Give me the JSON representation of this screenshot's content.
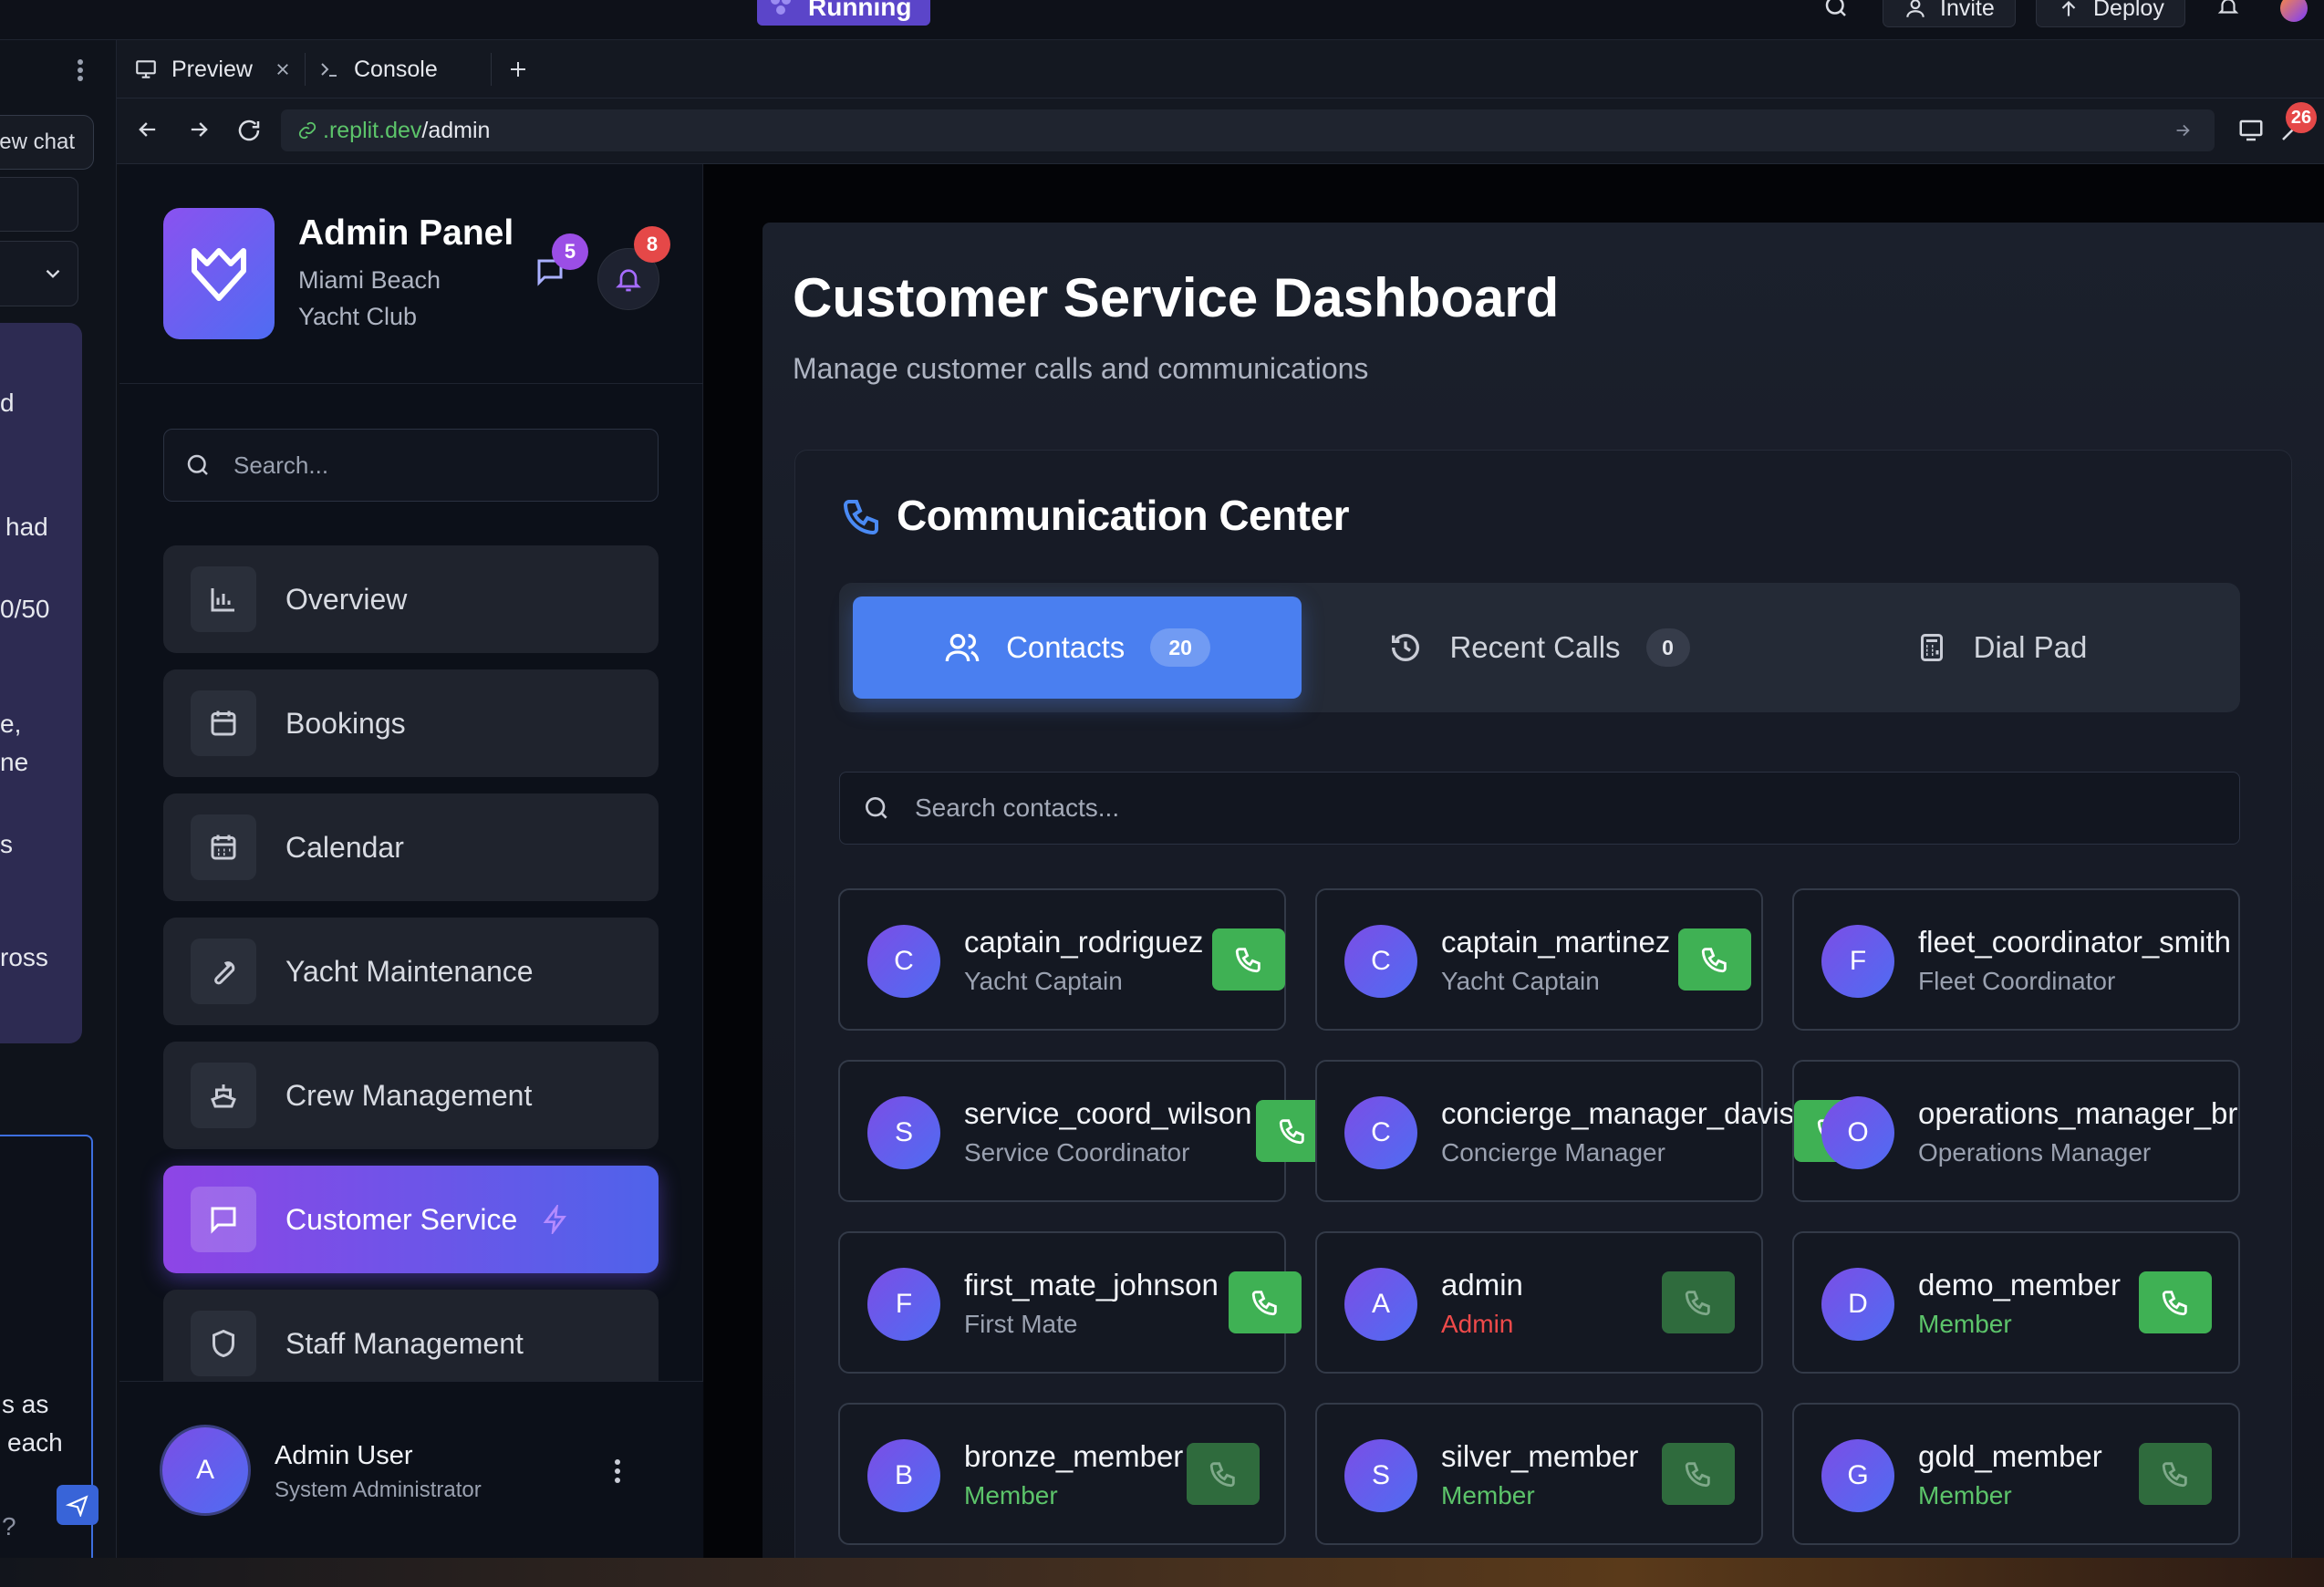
{
  "ide": {
    "running_label": "Running",
    "invite_label": "Invite",
    "deploy_label": "Deploy",
    "error_count": "26"
  },
  "left_panel": {
    "new_chat_label": "ew chat",
    "fragments": [
      "d",
      "had",
      "0/50",
      "e,",
      "ne",
      "s",
      "ross",
      "s as",
      "each",
      "?"
    ]
  },
  "tabs": {
    "preview": "Preview",
    "console": "Console"
  },
  "url": {
    "domain": ".replit.dev",
    "path": "/admin"
  },
  "sidebar": {
    "title": "Admin Panel",
    "subtitle_line1": "Miami Beach",
    "subtitle_line2": "Yacht Club",
    "messages_badge": "5",
    "notifications_badge": "8",
    "search_placeholder": "Search...",
    "items": [
      {
        "label": "Overview",
        "icon": "bar-chart-icon"
      },
      {
        "label": "Bookings",
        "icon": "calendar-icon"
      },
      {
        "label": "Calendar",
        "icon": "calendar-grid-icon"
      },
      {
        "label": "Yacht Maintenance",
        "icon": "wrench-icon"
      },
      {
        "label": "Crew Management",
        "icon": "ship-icon"
      },
      {
        "label": "Customer Service",
        "icon": "message-square-icon"
      },
      {
        "label": "Staff Management",
        "icon": "shield-icon"
      }
    ],
    "user": {
      "initial": "A",
      "name": "Admin User",
      "role": "System Administrator"
    }
  },
  "dashboard": {
    "title": "Customer Service Dashboard",
    "subtitle": "Manage customer calls and communications",
    "section_title": "Communication Center",
    "tabs": [
      {
        "label": "Contacts",
        "count": "20"
      },
      {
        "label": "Recent Calls",
        "count": "0"
      },
      {
        "label": "Dial Pad"
      }
    ],
    "contact_search_placeholder": "Search contacts...",
    "contacts": [
      {
        "initial": "C",
        "name": "captain_rodriguez",
        "role": "Yacht Captain",
        "role_style": "default",
        "call_enabled": true
      },
      {
        "initial": "C",
        "name": "captain_martinez",
        "role": "Yacht Captain",
        "role_style": "default",
        "call_enabled": true
      },
      {
        "initial": "F",
        "name": "fleet_coordinator_smith",
        "role": "Fleet Coordinator",
        "role_style": "default",
        "call_enabled": true
      },
      {
        "initial": "S",
        "name": "service_coord_wilson",
        "role": "Service Coordinator",
        "role_style": "default",
        "call_enabled": true
      },
      {
        "initial": "C",
        "name": "concierge_manager_davis",
        "role": "Concierge Manager",
        "role_style": "default",
        "call_enabled": true
      },
      {
        "initial": "O",
        "name": "operations_manager_br",
        "role": "Operations Manager",
        "role_style": "default",
        "call_enabled": true
      },
      {
        "initial": "F",
        "name": "first_mate_johnson",
        "role": "First Mate",
        "role_style": "default",
        "call_enabled": true
      },
      {
        "initial": "A",
        "name": "admin",
        "role": "Admin",
        "role_style": "admin",
        "call_enabled": false
      },
      {
        "initial": "D",
        "name": "demo_member",
        "role": "Member",
        "role_style": "member",
        "call_enabled": true
      },
      {
        "initial": "B",
        "name": "bronze_member",
        "role": "Member",
        "role_style": "member",
        "call_enabled": false
      },
      {
        "initial": "S",
        "name": "silver_member",
        "role": "Member",
        "role_style": "member",
        "call_enabled": false
      },
      {
        "initial": "G",
        "name": "gold_member",
        "role": "Member",
        "role_style": "member",
        "call_enabled": false
      }
    ]
  },
  "colors": {
    "accent_blue": "#4a7ff0",
    "accent_purple": "#8e45e6",
    "call_green": "#3fb154",
    "member_green": "#5cc46a",
    "admin_red": "#ef4a4a",
    "badge_purple": "#9b4ee6",
    "badge_red": "#e54848"
  }
}
